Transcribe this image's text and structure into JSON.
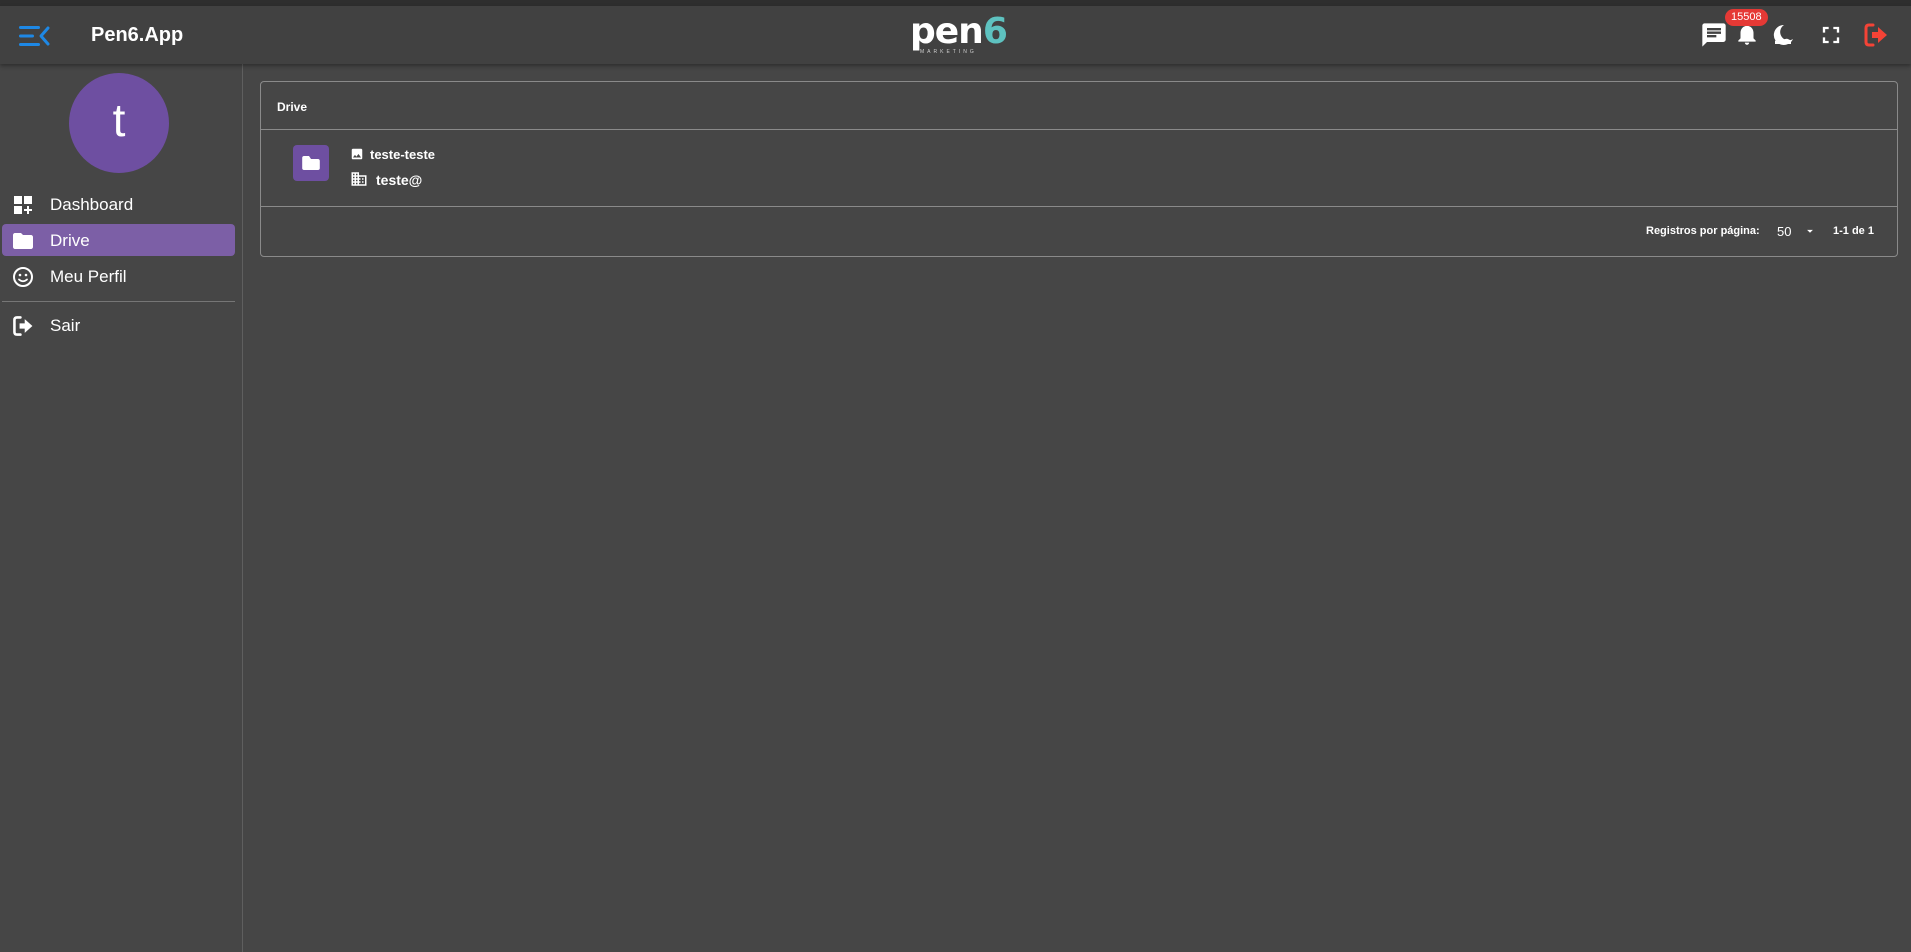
{
  "app": {
    "title": "Pen6.App"
  },
  "logo": {
    "main": "pen",
    "accent": "6",
    "sub": "MARKETING"
  },
  "topbar": {
    "icons": [
      "menu-fold-icon",
      "chat-icon",
      "bell-icon",
      "moon-icon",
      "fullscreen-icon",
      "logout-icon"
    ],
    "notification_count": "15508"
  },
  "colors": {
    "menu_icon": "#1e88e5",
    "badge": "#e53935",
    "logout_icon": "#f44336",
    "purple": "#6e4fa1",
    "active_nav": "#7c5fa6",
    "logo_accent": "#5ec2c0"
  },
  "user": {
    "avatar_letter": "t"
  },
  "sidebar": {
    "items": [
      {
        "label": "Dashboard",
        "icon": "dashboard-icon",
        "active": false
      },
      {
        "label": "Drive",
        "icon": "folder-icon",
        "active": true
      },
      {
        "label": "Meu Perfil",
        "icon": "smiley-icon",
        "active": false
      }
    ],
    "logout": {
      "label": "Sair",
      "icon": "logout-icon"
    }
  },
  "drive": {
    "title": "Drive",
    "rows": [
      {
        "name": "teste-teste",
        "name_icon": "image-icon",
        "company": "teste@",
        "company_icon": "building-icon",
        "type_icon": "folder-icon"
      }
    ],
    "footer": {
      "per_page_label": "Registros por página:",
      "per_page_value": "50",
      "range": "1-1 de 1"
    }
  }
}
